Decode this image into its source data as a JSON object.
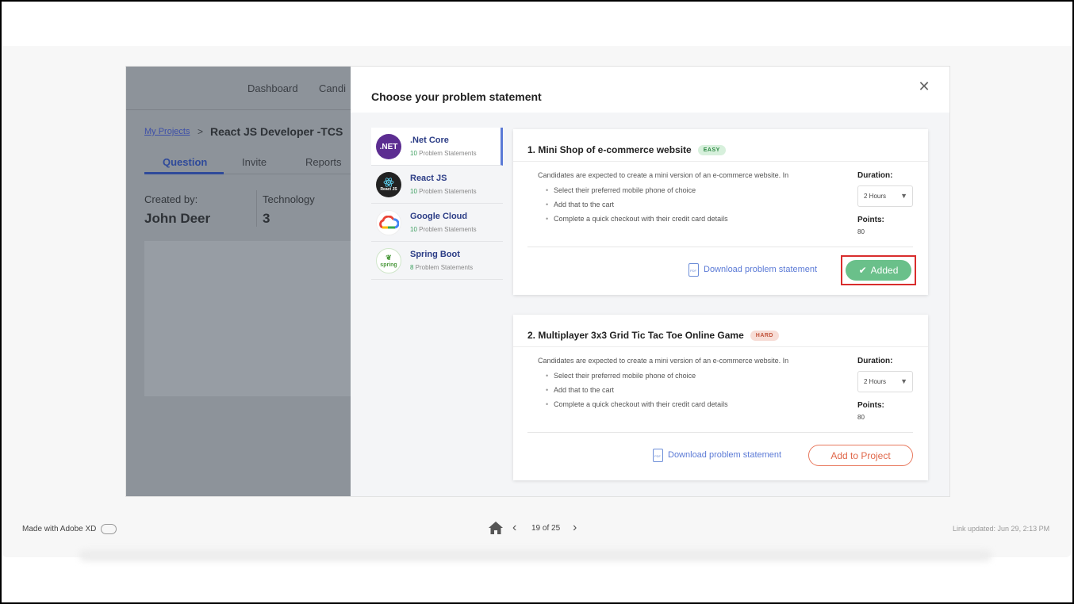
{
  "background_page": {
    "nav": {
      "dashboard": "Dashboard",
      "candidates": "Candi"
    },
    "breadcrumb": {
      "link": "My Projects",
      "separator": ">",
      "title": "React JS  Developer -TCS"
    },
    "tabs": [
      {
        "label": "Question"
      },
      {
        "label": "Invite"
      },
      {
        "label": "Reports"
      }
    ],
    "created_by_label": "Created by:",
    "created_by_value": "John Deer",
    "technology_label": "Technology",
    "technology_value": "3"
  },
  "modal": {
    "title": "Choose your problem statement",
    "close_icon": "close-icon",
    "technologies": [
      {
        "name": ".Net Core",
        "count": "10",
        "count_suffix": " Problem Statements",
        "logo": ".NET",
        "logo_color": "#5c2d91"
      },
      {
        "name": "React JS",
        "count": "10",
        "count_suffix": " Problem Statements",
        "logo": "React JS",
        "logo_color": "#222222"
      },
      {
        "name": "Google Cloud",
        "count": "10",
        "count_suffix": " Problem Statements",
        "logo": "google-cloud-icon",
        "logo_color": "#ffffff"
      },
      {
        "name": "Spring Boot",
        "count": "8",
        "count_suffix": " Problem Statements",
        "logo": "spring",
        "logo_color": "#ffffff"
      }
    ],
    "problems": [
      {
        "title": "1.  Mini Shop of e-commerce website",
        "difficulty": "EASY",
        "description": "Candidates are expected to create a mini version of an e-commerce website. In",
        "bullets": [
          "Select their preferred mobile phone of choice",
          "Add that to the cart",
          "Complete a quick checkout with their credit card details"
        ],
        "duration_label": "Duration:",
        "duration_value": "2 Hours",
        "points_label": "Points:",
        "points_value": "80",
        "download_label": "Download problem statement",
        "action_label": "Added",
        "action_state": "added"
      },
      {
        "title": "2.  Multiplayer 3x3 Grid Tic Tac Toe Online Game",
        "difficulty": "HARD",
        "description": "Candidates are expected to create a mini version of an e-commerce website. In",
        "bullets": [
          "Select their preferred mobile phone of choice",
          "Add that to the cart",
          "Complete a quick checkout with their credit card details"
        ],
        "duration_label": "Duration:",
        "duration_value": "2 Hours",
        "points_label": "Points:",
        "points_value": "80",
        "download_label": "Download problem statement",
        "action_label": "Add to Project",
        "action_state": "add"
      }
    ]
  },
  "viewer": {
    "made_with": "Made with Adobe XD",
    "page_indicator": "19 of 25",
    "link_updated": "Link updated: Jun 29, 2:13 PM"
  },
  "colors": {
    "accent_blue": "#5b7ad6",
    "added_green": "#6ac08a",
    "add_orange": "#e0674a",
    "highlight_red": "#d92d2d",
    "dim_overlay": "#8d939a"
  }
}
